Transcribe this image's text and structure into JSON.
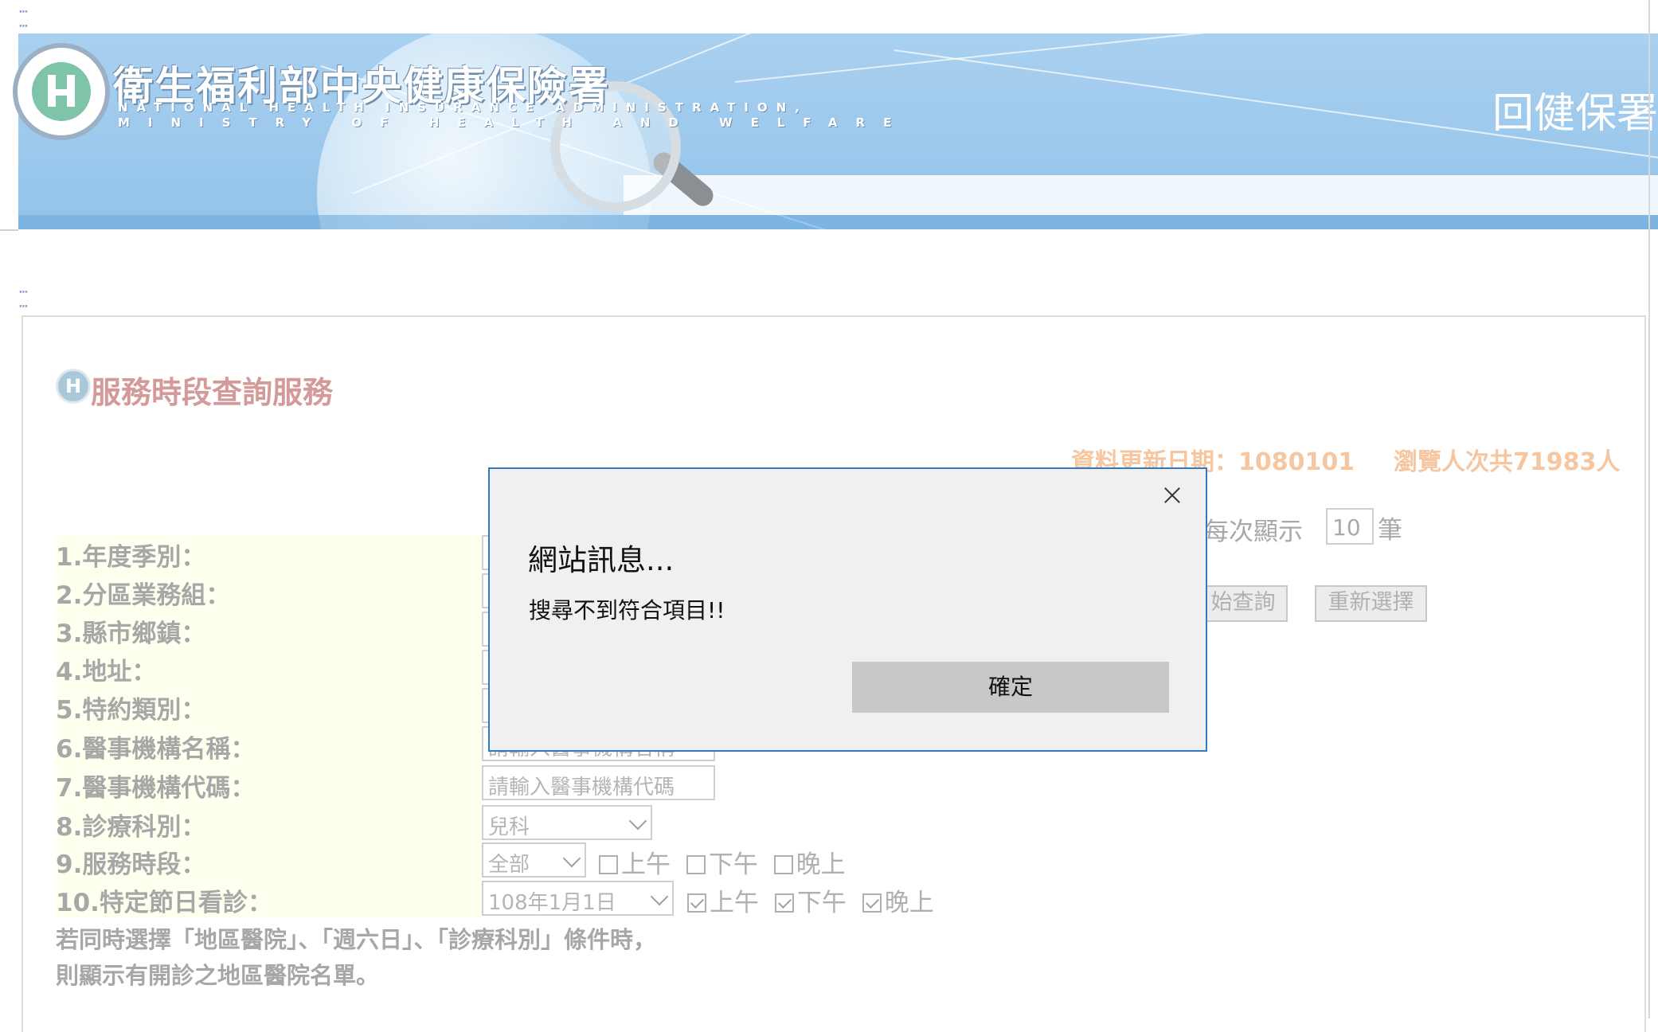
{
  "header": {
    "org_name_zh": "衛生福利部中央健康保險署",
    "org_name_en_line1": "NATIONAL HEALTH INSURANCE ADMINISTRATION,",
    "org_name_en_line2": "MINISTRY OF HEALTH AND WELFARE",
    "back_link": "回健保署",
    "logo_icon": "nhi-seal-logo",
    "banner_image": "globe-magnifier-banner"
  },
  "page": {
    "title": "服務時段查詢服務",
    "title_icon": "nhi-h-icon",
    "update_date": "資料更新日期：1080101",
    "visit_count": "瀏覽人次共71983人",
    "per_page_label": "每次顯示",
    "per_page_value": "10",
    "per_page_unit": "筆",
    "search_button": "始查詢",
    "reset_button": "重新選擇"
  },
  "form": {
    "fields": [
      {
        "label": "1.年度季別："
      },
      {
        "label": "2.分區業務組："
      },
      {
        "label": "3.縣市鄉鎮："
      },
      {
        "label": "4.地址："
      },
      {
        "label": "5.特約類別："
      },
      {
        "label": "6.醫事機構名稱：",
        "placeholder": "請輸入醫事機構名稱"
      },
      {
        "label": "7.醫事機構代碼：",
        "placeholder": "請輸入醫事機構代碼"
      },
      {
        "label": "8.診療科別：",
        "value": "兒科"
      },
      {
        "label": "9.服務時段：",
        "value": "全部",
        "options": [
          "上午",
          "下午",
          "晚上"
        ],
        "checked": [
          false,
          false,
          false
        ]
      },
      {
        "label": "10.特定節日看診：",
        "value": "108年1月1日",
        "options": [
          "上午",
          "下午",
          "晚上"
        ],
        "checked": [
          true,
          true,
          true
        ]
      }
    ],
    "note_line1": "若同時選擇「地區醫院」、「週六日」、「診療科別」條件時，",
    "note_line2": "則顯示有開診之地區醫院名單。"
  },
  "dialog": {
    "title": "網站訊息...",
    "message": "搜尋不到符合項目!!",
    "ok_button": "確定",
    "close_icon": "close-icon"
  },
  "colors": {
    "banner": "#93c3ea",
    "title": "#d49a9a",
    "info_text": "#f5c6a0",
    "form_label_bg": "#fffff0",
    "dialog_border": "#2f7bc3",
    "dialog_bg": "#f0f0f0",
    "ok_button_bg": "#c8c8c8"
  }
}
